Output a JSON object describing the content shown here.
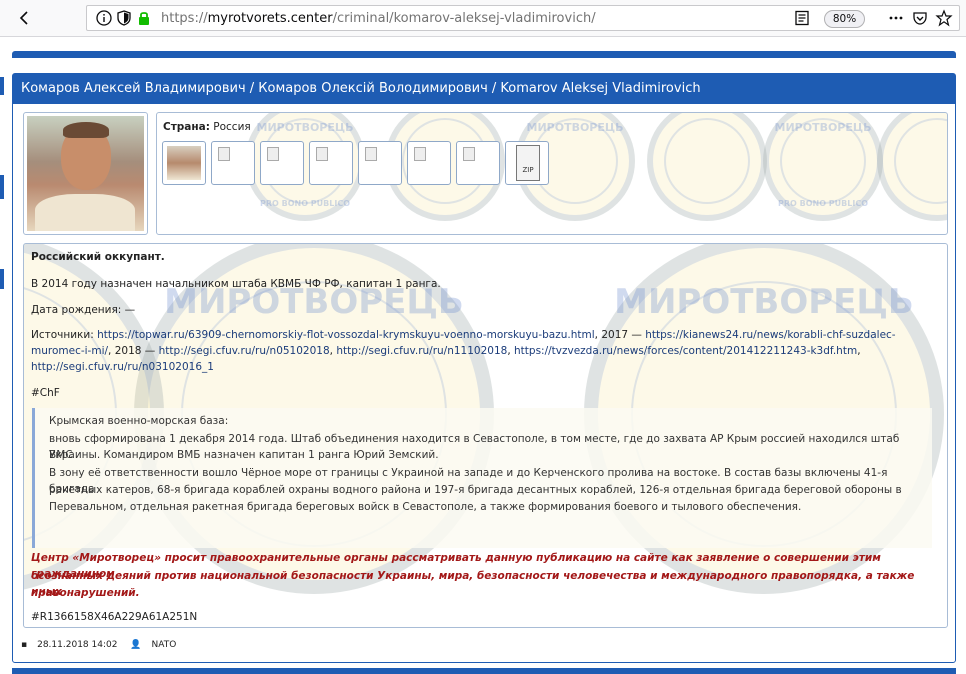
{
  "browser": {
    "url_prefix": "https://",
    "url_domain": "myrotvorets.center",
    "url_path": "/criminal/komarov-aleksej-vladimirovich/",
    "zoom": "80%"
  },
  "header": {
    "title": "Комаров Алексей Владимирович / Комаров Олексій Володимирович / Komarov Aleksej Vladimirovich"
  },
  "info": {
    "country_label": "Страна:",
    "country_value": "Россия",
    "zip_label": "ZIP"
  },
  "watermark": {
    "seal_top": "МИРОТВОРЕЦЬ",
    "seal_bottom": "PRO BONO PUBLICO"
  },
  "body": {
    "heading": "Российский оккупант.",
    "p1": "В 2014 году назначен начальником штаба КВМБ ЧФ РФ, капитан 1 ранга.",
    "dob": "Дата рождения: —",
    "sources_label": "Источники:",
    "sources": [
      {
        "text": "https://topwar.ru/63909-chernomorskiy-flot-vossozdal-krymskuyu-voenno-morskuyu-bazu.html",
        "after": ", 2017 —"
      },
      {
        "text": "https://kianews24.ru/news/korabli-chf-suzdalec-muromec-i-mi/",
        "after": ", 2018 —"
      },
      {
        "text": "http://segi.cfuv.ru/ru/n05102018",
        "after": ","
      },
      {
        "text": "http://segi.cfuv.ru/ru/n11102018",
        "after": ","
      },
      {
        "text": "https://tvzvezda.ru/news/forces/content/201412211243-k3df.htm",
        "after": ","
      },
      {
        "text": "http://segi.cfuv.ru/ru/n03102016_1",
        "after": ""
      }
    ],
    "src_line1": "https://topwar.ru/63909-chernomorskiy-flot-vossozdal-krymskuyu-voenno-morskuyu-bazu.html, 2017 — https://kianews24.ru/news/korabli-chf-suzdalec-muromec-",
    "src_line2": "i-mi/, 2018 — http://segi.cfuv.ru/ru/n05102018, http://segi.cfuv.ru/ru/n11102018, https://tvzvezda.ru/news/forces/content/201412211243-k3df.htm, http://segi.cfuv.ru",
    "src_line3": "/ru/n03102016_1",
    "tag": "#ChF",
    "quote": [
      "Крымская военно-морская база:",
      "вновь сформирована 1 декабря 2014 года. Штаб объединения находится в Севастополе, в том месте, где до захвата АР Крым россией находился штаб ВМС",
      "Украины. Командиром ВМБ назначен капитан 1 ранга Юрий Земский.",
      "В зону её ответственности вошло Чёрное море от границы с Украиной на западе и до Керченского пролива на востоке. В состав базы включены 41-я бригада",
      "ракетных катеров, 68-я бригада кораблей охраны водного района и 197-я бригада десантных кораблей, 126-я отдельная бригада береговой обороны в",
      "Перевальном, отдельная ракетная бригада береговых войск в Севастополе, а также формирования боевого и тылового обеспечения."
    ],
    "warning": [
      "Центр «Миротворец» просит правоохранительные органы рассматривать данную публикацию на сайте как заявление о совершении этим гражданином",
      "осознанных деяний против национальной безопасности Украины, мира, безопасности человечества и международного правопорядка, а также иных",
      "правонарушений."
    ],
    "record_id": "#R1366158X46A229A61A251N"
  },
  "footer": {
    "date": "28.11.2018 14:02",
    "author": "NATO"
  },
  "colors": {
    "accent": "#1e5cb3",
    "warning": "#a31818"
  }
}
